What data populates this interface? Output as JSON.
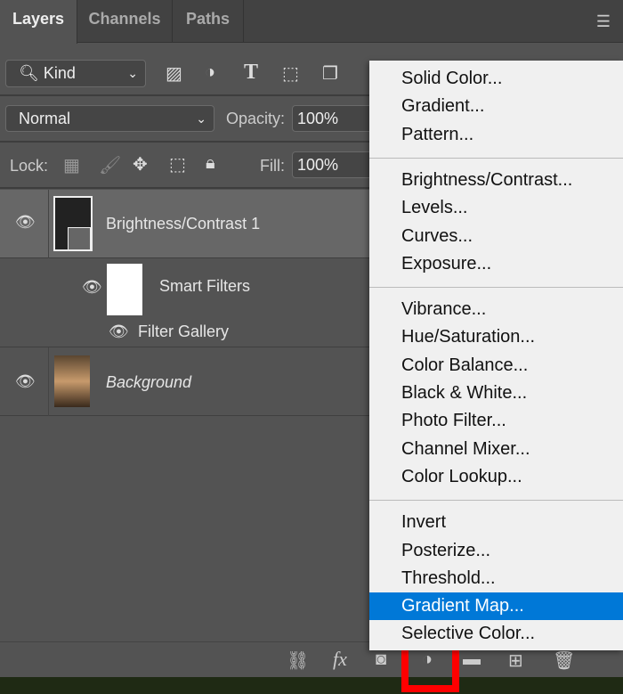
{
  "tabs": [
    "Layers",
    "Channels",
    "Paths"
  ],
  "filter": {
    "label": "Kind"
  },
  "blend": {
    "mode": "Normal",
    "opacity_label": "Opacity:",
    "opacity": "100%"
  },
  "lock": {
    "label": "Lock:",
    "fill_label": "Fill:",
    "fill": "100%"
  },
  "layers": [
    {
      "name": "Brightness/Contrast 1",
      "selected": true
    },
    {
      "name": "Smart Filters"
    },
    {
      "name": "Filter Gallery"
    },
    {
      "name": "Background"
    }
  ],
  "menu": {
    "groups": [
      [
        "Solid Color...",
        "Gradient...",
        "Pattern..."
      ],
      [
        "Brightness/Contrast...",
        "Levels...",
        "Curves...",
        "Exposure..."
      ],
      [
        "Vibrance...",
        "Hue/Saturation...",
        "Color Balance...",
        "Black & White...",
        "Photo Filter...",
        "Channel Mixer...",
        "Color Lookup..."
      ],
      [
        "Invert",
        "Posterize...",
        "Threshold...",
        "Gradient Map...",
        "Selective Color..."
      ]
    ],
    "highlighted": "Gradient Map...",
    "highlight_color": "#0078d7"
  },
  "bottom_icons": [
    "link-icon",
    "fx-icon",
    "mask-icon",
    "adjustment-icon",
    "folder-icon",
    "new-layer-icon",
    "trash-icon"
  ],
  "highlight_box_color": "#ff0000"
}
